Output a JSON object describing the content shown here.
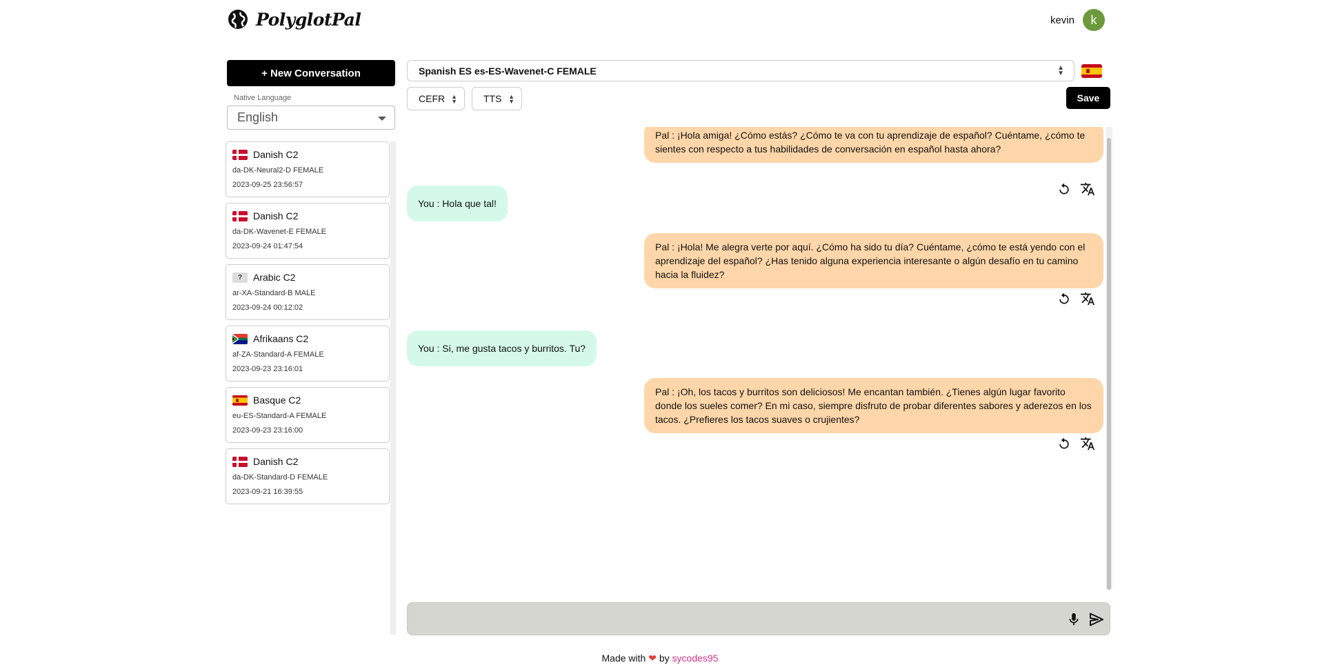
{
  "app": {
    "name": "PolyglotPal",
    "user_name": "kevin",
    "user_initial": "k"
  },
  "sidebar": {
    "new_conversation_label": "+ New Conversation",
    "native_language_label": "Native Language",
    "native_language_value": "English",
    "conversations": [
      {
        "title": "Danish C2",
        "flag": "dk",
        "voice": "da-DK-Neural2-D FEMALE",
        "date": "2023-09-25 23:56:57"
      },
      {
        "title": "Danish C2",
        "flag": "dk",
        "voice": "da-DK-Wavenet-E FEMALE",
        "date": "2023-09-24 01:47:54"
      },
      {
        "title": "Arabic C2",
        "flag": "unknown",
        "flag_text": "?",
        "voice": "ar-XA-Standard-B MALE",
        "date": "2023-09-24 00:12:02"
      },
      {
        "title": "Afrikaans C2",
        "flag": "za",
        "voice": "af-ZA-Standard-A FEMALE",
        "date": "2023-09-23 23:16:01"
      },
      {
        "title": "Basque C2",
        "flag": "es",
        "voice": "eu-ES-Standard-A FEMALE",
        "date": "2023-09-23 23:16:00"
      },
      {
        "title": "Danish C2",
        "flag": "dk",
        "voice": "da-DK-Standard-D FEMALE",
        "date": "2023-09-21 16:39:55"
      }
    ]
  },
  "toolbar": {
    "voice_value": "Spanish ES es-ES-Wavenet-C FEMALE",
    "cefr_label": "CEFR",
    "tts_label": "TTS",
    "save_label": "Save"
  },
  "messages": [
    {
      "role": "pal",
      "text": "Pal : ¡Hola amiga! ¿Cómo estás? ¿Cómo te va con tu aprendizaje de español? Cuéntame, ¿cómo te sientes con respecto a tus habilidades de conversación en español hasta ahora?"
    },
    {
      "role": "you",
      "text": "You : Hola que tal!"
    },
    {
      "role": "pal",
      "text": "Pal : ¡Hola! Me alegra verte por aquí. ¿Cómo ha sido tu día? Cuéntame, ¿cómo te está yendo con el aprendizaje del español? ¿Has tenido alguna experiencia interesante o algún desafío en tu camino hacia la fluidez?"
    },
    {
      "role": "you",
      "text": "You : Si, me gusta tacos y burritos. Tu?"
    },
    {
      "role": "pal",
      "text": "Pal : ¡Oh, los tacos y burritos son deliciosos! Me encantan también. ¿Tienes algún lugar favorito donde los sueles comer? En mi caso, siempre disfruto de probar diferentes sabores y aderezos en los tacos. ¿Prefieres los tacos suaves o crujientes?"
    }
  ],
  "input": {
    "value": "",
    "placeholder": ""
  },
  "footer": {
    "made_with": "Made with",
    "by": "by",
    "author": "sycodes95"
  },
  "colors": {
    "pal_bubble": "#fed6a9",
    "you_bubble": "#d5f9e9",
    "avatar": "#6c9a3a",
    "author_link": "#d63384"
  }
}
